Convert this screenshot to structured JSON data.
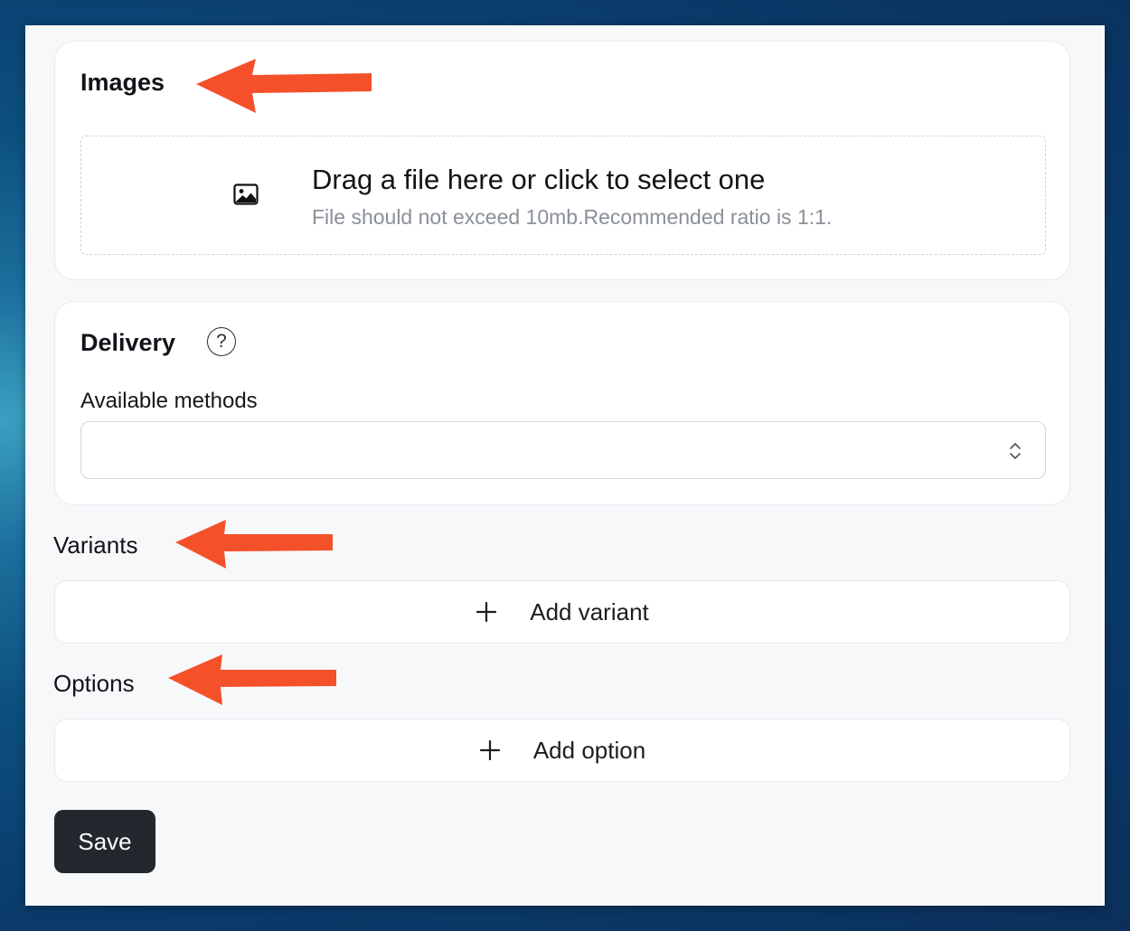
{
  "images": {
    "title": "Images",
    "dropzone": {
      "icon": "image-icon",
      "main_text": "Drag a file here or click to select one",
      "sub_text": "File should not exceed 10mb.Recommended ratio is 1:1."
    }
  },
  "delivery": {
    "title": "Delivery",
    "help_icon": "question-circle-icon",
    "help_glyph": "?",
    "methods_label": "Available methods",
    "methods_value": ""
  },
  "variants": {
    "title": "Variants",
    "add_label": "Add variant"
  },
  "options": {
    "title": "Options",
    "add_label": "Add option"
  },
  "save_label": "Save",
  "annotation_color": "#f4502a"
}
